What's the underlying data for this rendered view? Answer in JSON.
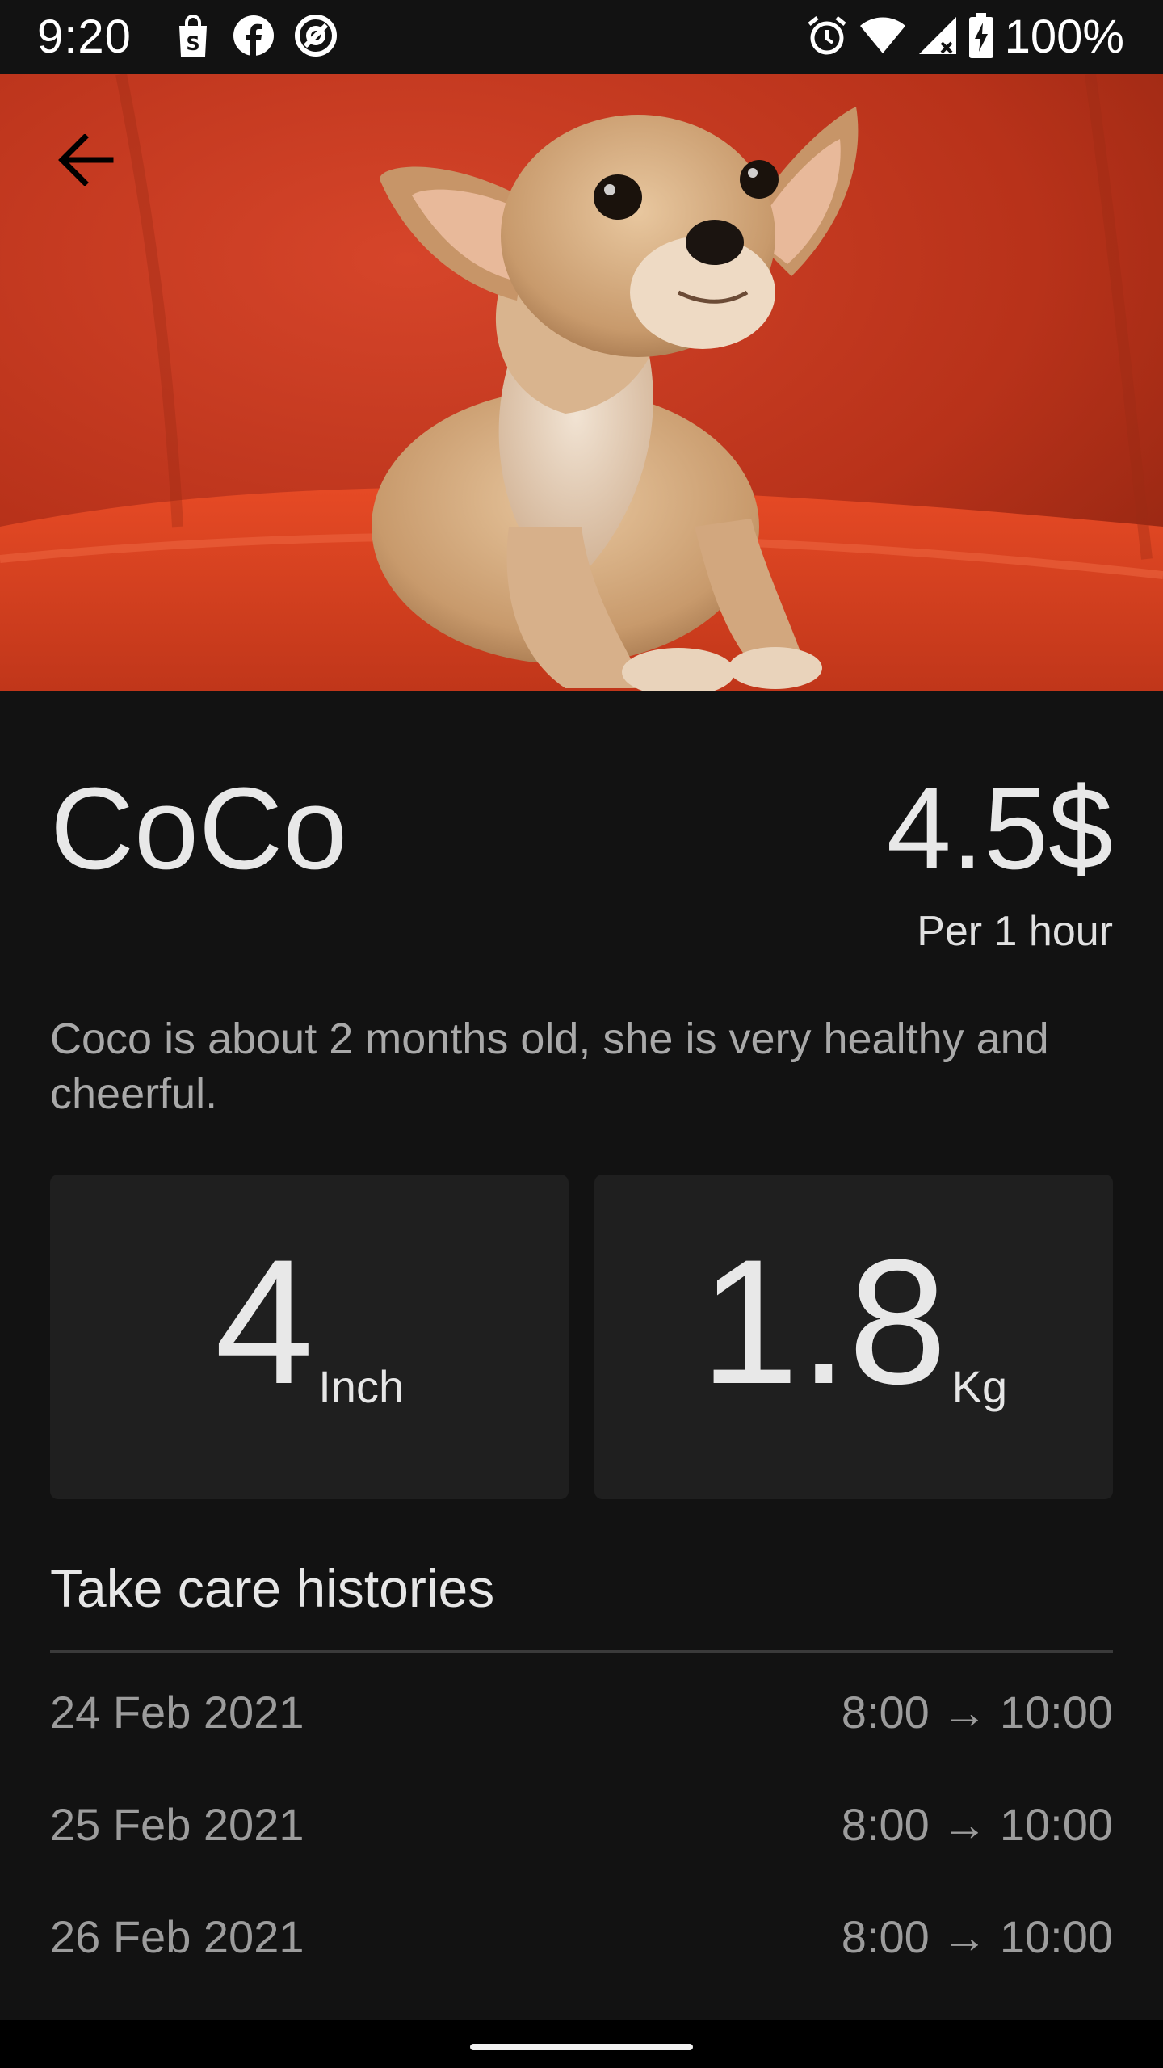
{
  "status_bar": {
    "time": "9:20",
    "battery_text": "100%",
    "left_icons": [
      "shopping-bag-icon",
      "facebook-icon",
      "at-sign-icon"
    ],
    "right_icons": [
      "alarm-icon",
      "wifi-icon",
      "signal-icon",
      "battery-charging-icon"
    ]
  },
  "hero": {
    "image_subject": "chihuahua on red chair",
    "back_icon": "arrow-left-icon"
  },
  "pet": {
    "name": "CoCo",
    "price": "4.5$",
    "price_unit": "Per 1 hour",
    "description": "Coco is about 2 months old, she is very healthy and cheerful."
  },
  "stats": {
    "height": {
      "value": "4",
      "unit": "Inch"
    },
    "weight": {
      "value": "1.8",
      "unit": "Kg"
    }
  },
  "histories": {
    "title": "Take care histories",
    "items": [
      {
        "date": "24 Feb 2021",
        "time": "8:00 → 10:00"
      },
      {
        "date": "25 Feb 2021",
        "time": "8:00 → 10:00"
      },
      {
        "date": "26 Feb 2021",
        "time": "8:00 → 10:00"
      }
    ]
  },
  "colors": {
    "background": "#121212",
    "card": "#1f1f1f",
    "hero_backdrop": "#c93a1c"
  }
}
